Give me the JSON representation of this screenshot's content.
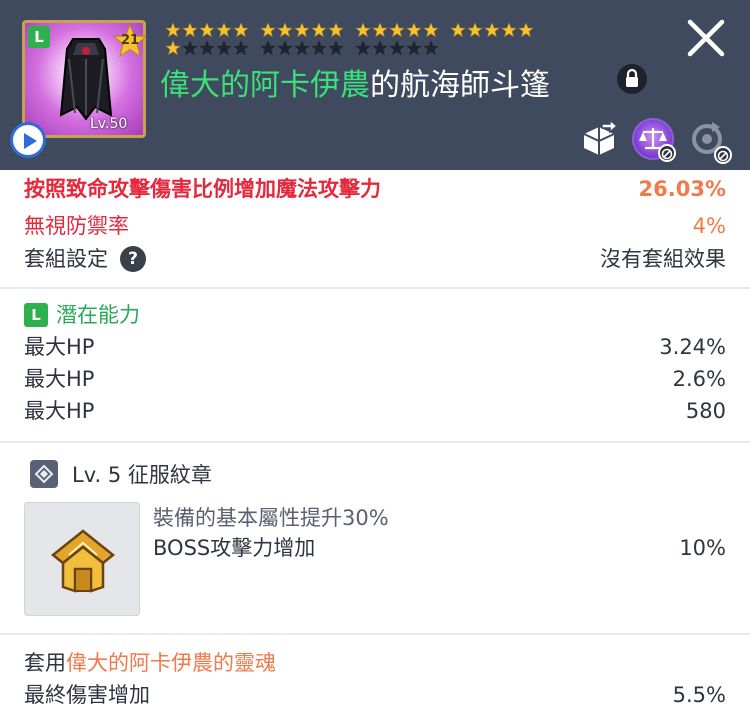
{
  "header": {
    "grade": "L",
    "star_count": "21",
    "item_level": "Lv.50",
    "title_green": "偉大的阿卡伊農",
    "title_white": "的航海師斗篷",
    "colors": {
      "header_bg": "#3f4a5e",
      "title_green": "#3be07a",
      "star_gold": "#f5c232"
    },
    "icons": [
      "play-icon",
      "lock-icon",
      "close-icon",
      "transfer-icon",
      "scale-icon",
      "cycle-icon"
    ]
  },
  "stats": {
    "cut_label": "按照致命攻擊傷害比例增加魔法攻擊力",
    "cut_value": "26.03%",
    "ignore_def_label": "無視防禦率",
    "ignore_def_value": "4%",
    "set_label": "套組設定",
    "set_help": "?",
    "set_value": "沒有套組效果"
  },
  "potential": {
    "grade": "L",
    "title": "潛在能力",
    "lines": [
      {
        "label": "最大HP",
        "value": "3.24%"
      },
      {
        "label": "最大HP",
        "value": "2.6%"
      },
      {
        "label": "最大HP",
        "value": "580"
      }
    ]
  },
  "emblem": {
    "title": "Lv. 5 征服紋章",
    "desc": "裝備的基本屬性提升30%",
    "effect_label": "BOSS攻擊力增加",
    "effect_value": "10%"
  },
  "soul": {
    "prefix": "套用",
    "name": "偉大的阿卡伊農的靈魂",
    "effect_label": "最終傷害增加",
    "effect_value": "5.5%"
  }
}
